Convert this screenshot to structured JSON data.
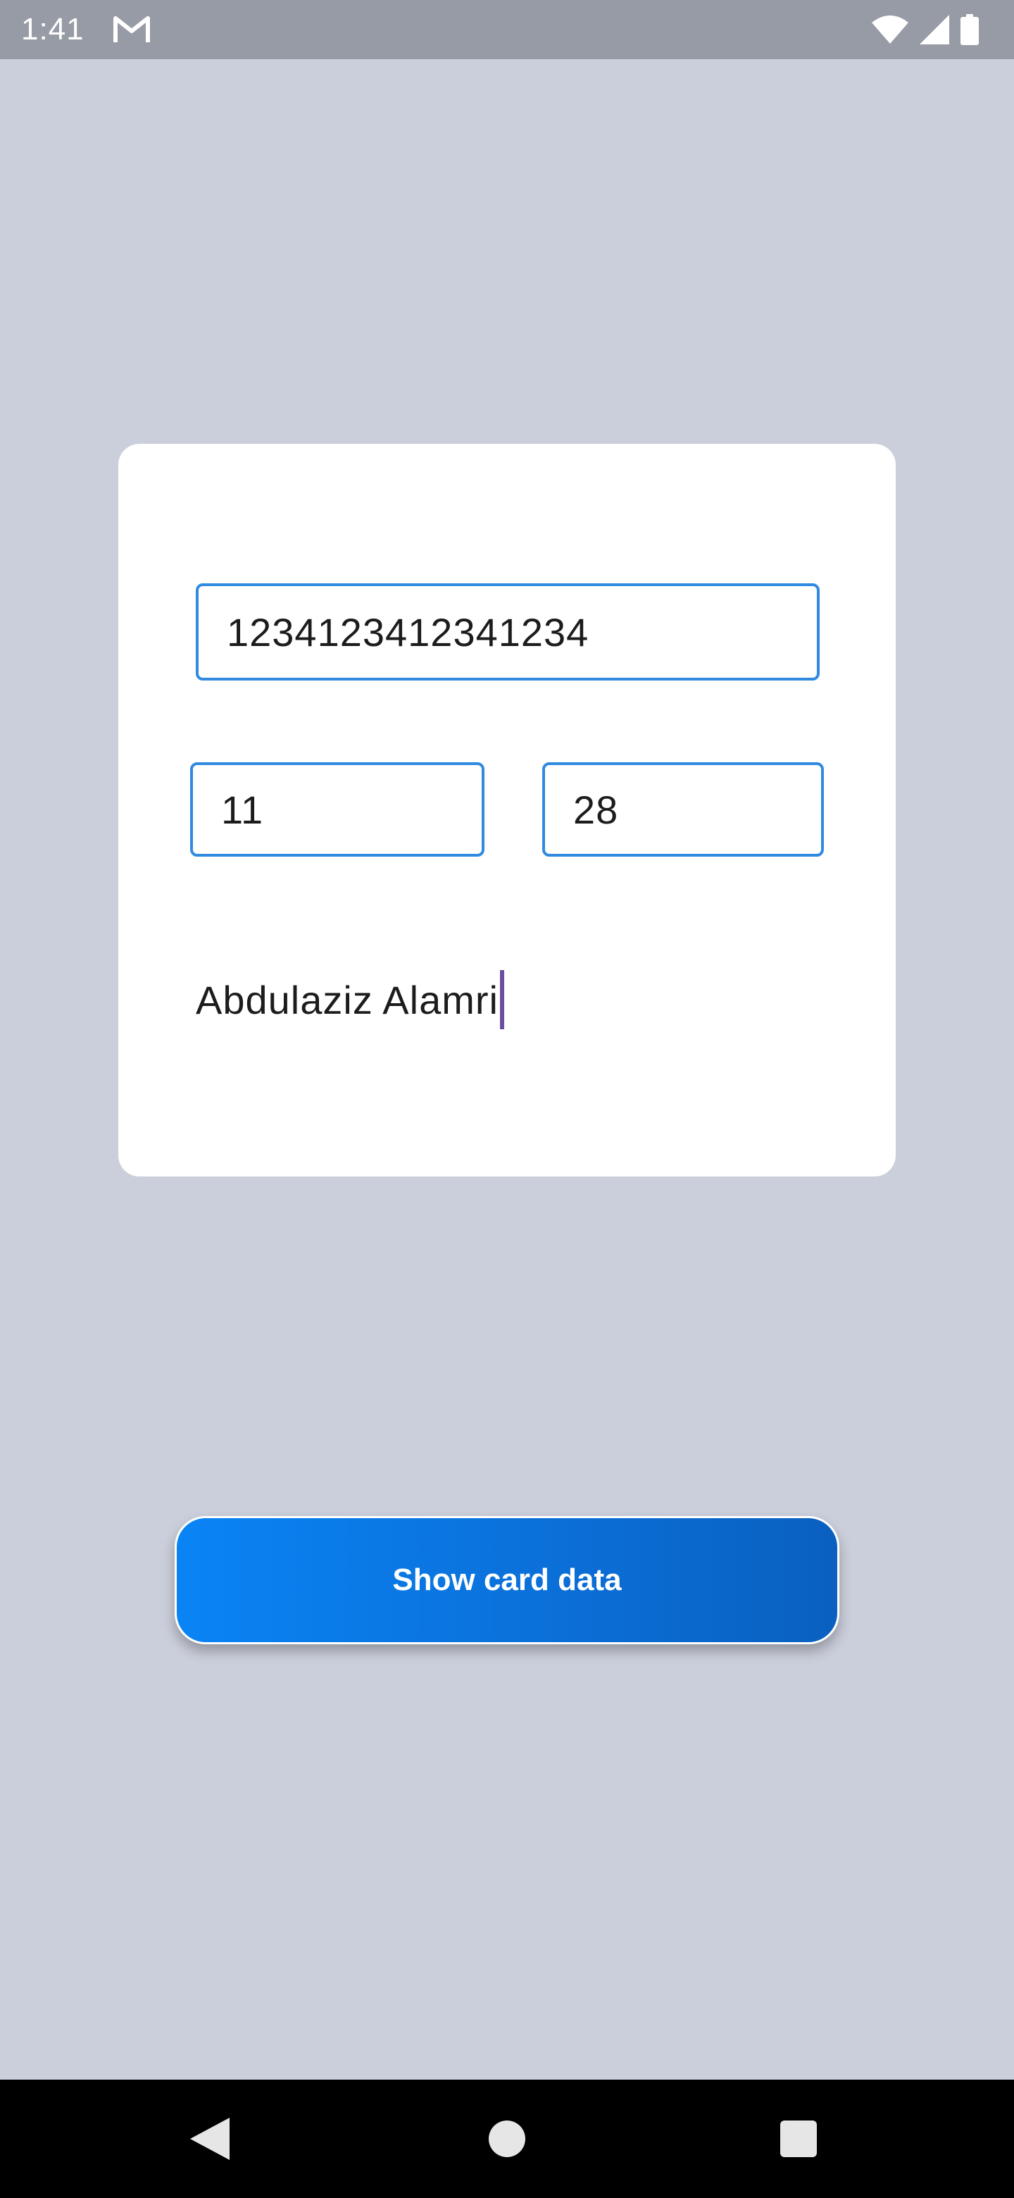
{
  "status_bar": {
    "time": "1:41",
    "icons": [
      "gmail-icon",
      "wifi-icon",
      "signal-icon",
      "battery-icon"
    ]
  },
  "card_form": {
    "card_number": "1234123412341234",
    "expiry_month": "11",
    "expiry_year": "28",
    "holder_name": "Abdulaziz Alamri"
  },
  "actions": {
    "show_card_data_label": "Show card data"
  },
  "nav_bar": {
    "icons": [
      "back-icon",
      "home-icon",
      "recents-icon"
    ]
  },
  "colors": {
    "background": "#cbcfdb",
    "status_bar": "#979ba5",
    "field_border": "#2f8ae0",
    "button_gradient_start": "#0a84f5",
    "button_gradient_end": "#0a60c0",
    "caret": "#6a4fa0"
  }
}
